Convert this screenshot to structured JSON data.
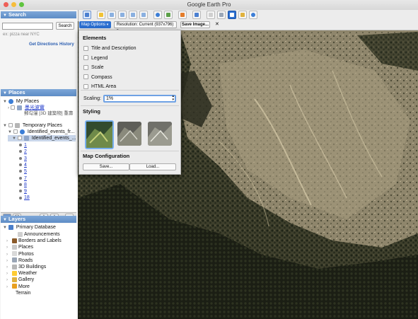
{
  "window": {
    "title": "Google Earth Pro"
  },
  "toolbar": {
    "map_options": "Map Options",
    "resolution": "Resolution: Current (937x796)",
    "save_image": "Save Image...",
    "close": "✕"
  },
  "search": {
    "header": "Search",
    "button": "Search",
    "placeholder": "ex: pizza near NYC",
    "get_directions": "Get Directions",
    "history": "History"
  },
  "places": {
    "header": "Places",
    "my_places": "My Places",
    "item1_title": "墨光波實",
    "item1_sub": "郵勾漫 [3D 建築物] 重壽",
    "temporary_places": "Temporary Places",
    "identified_folder": "Identified_events_fr...",
    "identified_sub": "Identified_events_...",
    "events": [
      "1",
      "2",
      "3",
      "4",
      "5",
      "7",
      "8",
      "9",
      "18"
    ]
  },
  "layers": {
    "header": "Layers",
    "primary": "Primary Database",
    "items": [
      "Announcements",
      "Borders and Labels",
      "Places",
      "Photos",
      "Roads",
      "3D Buildings",
      "Weather",
      "Gallery",
      "More",
      "Terrain"
    ]
  },
  "map_options": {
    "elements_header": "Elements",
    "checkboxes": [
      "Title and Description",
      "Legend",
      "Scale",
      "Compass",
      "HTML Area"
    ],
    "scaling_label": "Scaling:",
    "scaling_value": "1%",
    "styling_header": "Styling",
    "map_config_header": "Map Configuration",
    "save_btn": "Save...",
    "load_btn": "Load..."
  }
}
